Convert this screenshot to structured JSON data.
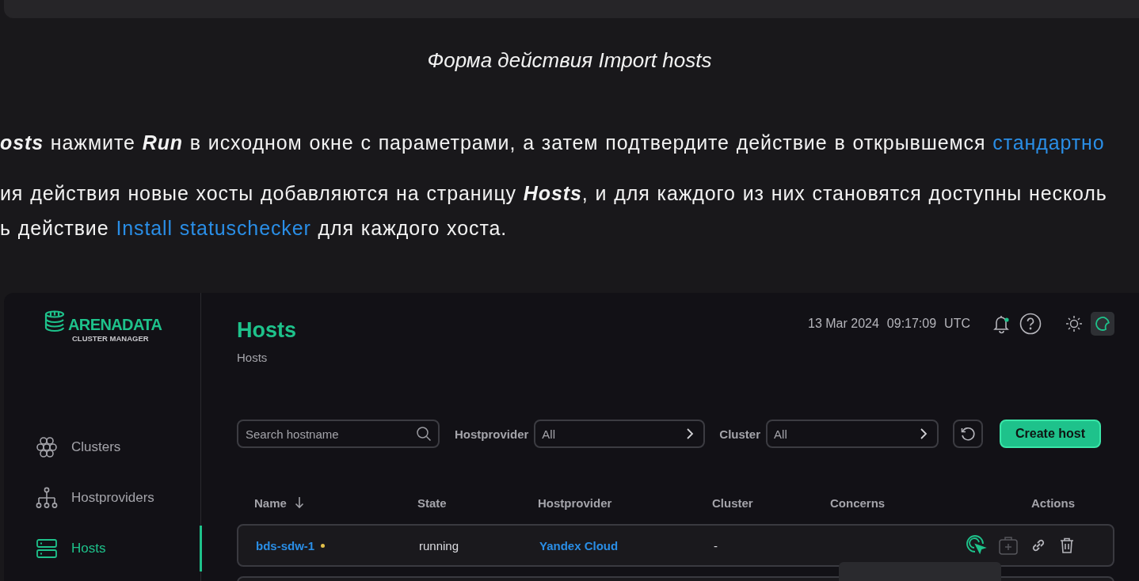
{
  "caption": "Форма действия Import hosts",
  "paragraphs": [
    {
      "segments": [
        {
          "kind": "emphasis",
          "text": "osts"
        },
        {
          "kind": "text",
          "text": " нажмите "
        },
        {
          "kind": "emphasis",
          "text": "Run"
        },
        {
          "kind": "text",
          "text": " в исходном окне с параметрами, а затем подтвердите действие в открывшемся "
        },
        {
          "kind": "link",
          "text": "стандартно"
        }
      ]
    },
    {
      "segments": [
        {
          "kind": "text",
          "text": "ия действия новые хосты добавляются на страницу "
        },
        {
          "kind": "emphasis",
          "text": "Hosts"
        },
        {
          "kind": "text",
          "text": ", и для каждого из них становятся доступны несколь"
        },
        {
          "kind": "break"
        },
        {
          "kind": "text",
          "text": "ь действие "
        },
        {
          "kind": "link",
          "text": "Install statuschecker"
        },
        {
          "kind": "text",
          "text": " для каждого хоста."
        }
      ]
    }
  ],
  "app": {
    "logo": {
      "name": "ARENADATA",
      "subtitle": "CLUSTER MANAGER"
    },
    "sidebar": {
      "items": [
        {
          "label": "Clusters",
          "kind": "clusters",
          "selected": false
        },
        {
          "label": "Hostproviders",
          "kind": "hostproviders",
          "selected": false
        },
        {
          "label": "Hosts",
          "kind": "hosts",
          "selected": true
        }
      ]
    },
    "header": {
      "title": "Hosts",
      "breadcrumb": "Hosts",
      "date": "13 Mar 2024",
      "time": "09:17:09",
      "timezone": "UTC",
      "notifications_unread": true,
      "dark_mode": true
    },
    "toolbar": {
      "search": {
        "placeholder": "Search hostname"
      },
      "filters": [
        {
          "label": "Hostprovider",
          "value": "All"
        },
        {
          "label": "Cluster",
          "value": "All"
        }
      ],
      "create_button": "Create host"
    },
    "table": {
      "columns": [
        {
          "label": "Name",
          "sorted": true
        },
        {
          "label": "State",
          "sorted": false
        },
        {
          "label": "Hostprovider",
          "sorted": false
        },
        {
          "label": "Cluster",
          "sorted": false
        },
        {
          "label": "Concerns",
          "sorted": false
        },
        {
          "label": "Actions",
          "sorted": false
        }
      ],
      "rows": [
        {
          "name": "bds-sdw-1",
          "has_concern": true,
          "state": "running",
          "hostprovider": "Yandex Cloud",
          "cluster": "-"
        }
      ]
    }
  }
}
